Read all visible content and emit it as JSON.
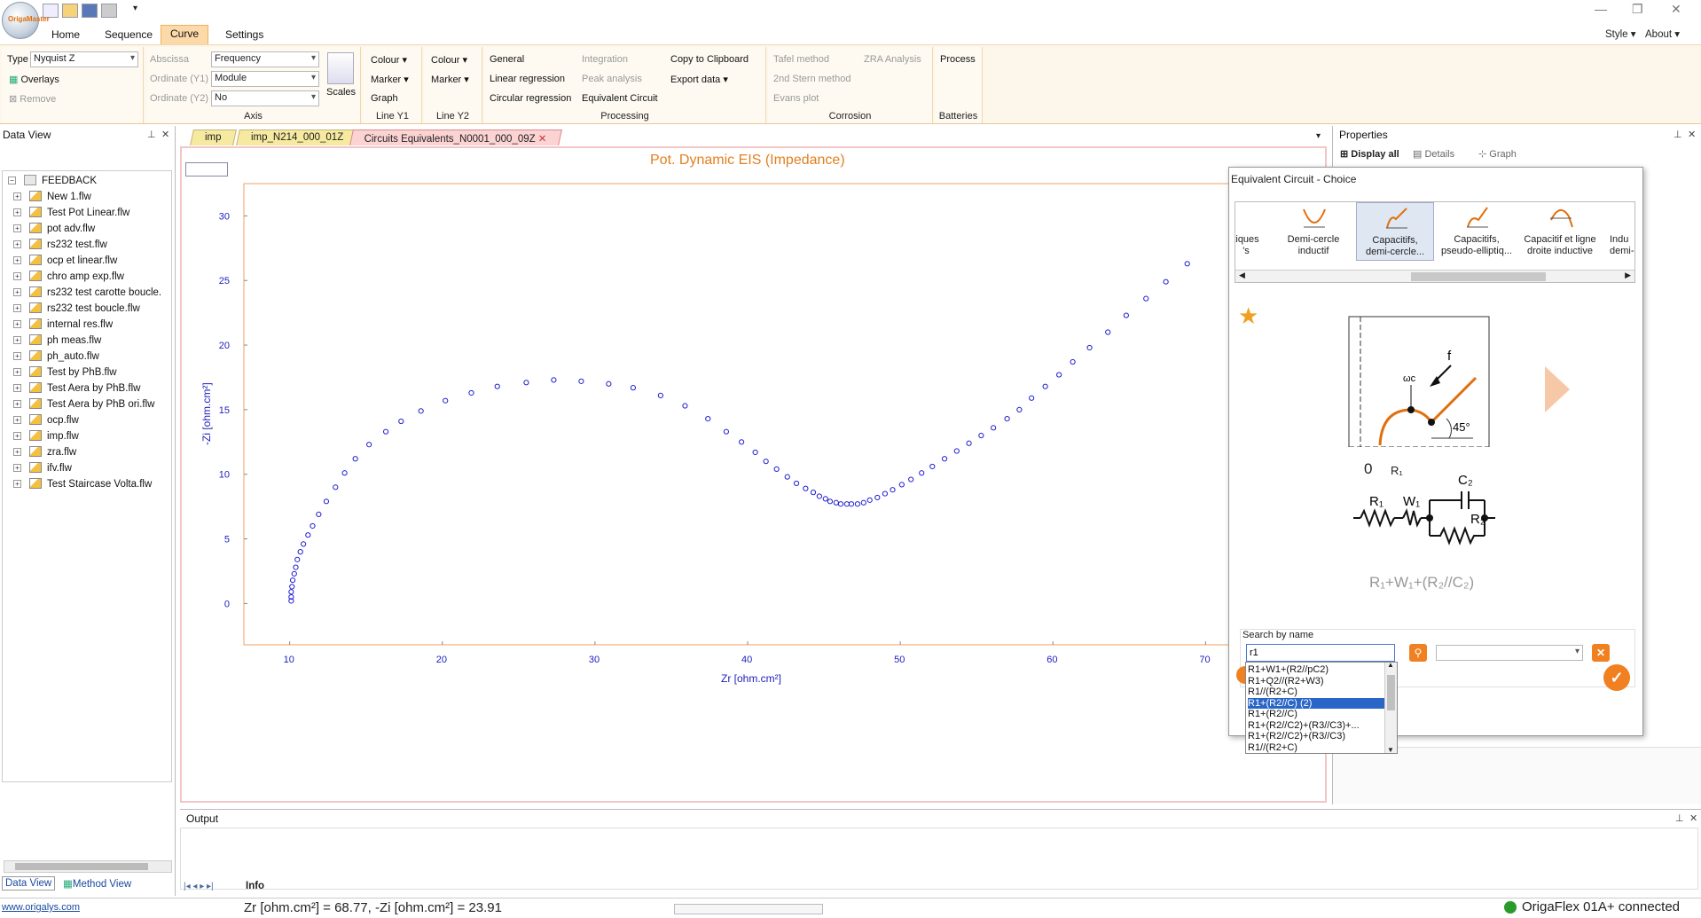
{
  "app": {
    "quick_access": [
      "new",
      "open",
      "save",
      "print"
    ],
    "style_label": "Style",
    "about_label": "About"
  },
  "ribbon": {
    "tabs": [
      "Home",
      "Sequence",
      "Curve",
      "Settings"
    ],
    "type_label": "Type",
    "type_value": "Nyquist Z",
    "overlays": "Overlays",
    "remove": "Remove",
    "abscissa_label": "Abscissa",
    "abscissa_value": "Frequency",
    "ordinate1_label": "Ordinate (Y1)",
    "ordinate1_value": "Module",
    "ordinate2_label": "Ordinate (Y2)",
    "ordinate2_value": "No",
    "scales": "Scales",
    "axis_group": "Axis",
    "colour": "Colour",
    "marker": "Marker",
    "graph": "Graph",
    "line_y1": "Line Y1",
    "line_y2": "Line Y2",
    "general": "General",
    "integration": "Integration",
    "copy_clipboard": "Copy to Clipboard",
    "linear_regression": "Linear regression",
    "peak_analysis": "Peak analysis",
    "export_data": "Export data",
    "circular_regression": "Circular regression",
    "equivalent_circuit": "Equivalent Circuit",
    "processing": "Processing",
    "tafel": "Tafel method",
    "zra": "ZRA Analysis",
    "stern": "2nd Stern method",
    "evans": "Evans plot",
    "corrosion": "Corrosion",
    "process": "Process",
    "batteries": "Batteries"
  },
  "dataview": {
    "title": "Data View",
    "root": "FEEDBACK",
    "items": [
      "New 1.flw",
      "Test Pot Linear.flw",
      "pot adv.flw",
      "rs232 test.flw",
      "ocp et linear.flw",
      "chro amp exp.flw",
      "rs232 test carotte boucle.",
      "rs232 test boucle.flw",
      "internal res.flw",
      "ph meas.flw",
      "ph_auto.flw",
      "Test by PhB.flw",
      "Test Aera by PhB.flw",
      "Test Aera by PhB ori.flw",
      "ocp.flw",
      "imp.flw",
      "zra.flw",
      "ifv.flw",
      "Test Staircase Volta.flw"
    ],
    "tab_data": "Data View",
    "tab_method": "Method View"
  },
  "doc_tabs": [
    "imp",
    "imp_N214_000_01Z",
    "Circuits Equivalents_N0001_000_09Z"
  ],
  "chart_data": {
    "type": "scatter",
    "title": "Pot. Dynamic EIS (Impedance)",
    "xlabel": "Zr [ohm.cm²]",
    "ylabel": "-Zi [ohm.cm²]",
    "xlim": [
      7,
      73
    ],
    "ylim": [
      -3.2,
      32.5
    ],
    "xticks": [
      10,
      20,
      30,
      40,
      50,
      60,
      70
    ],
    "yticks": [
      0,
      5,
      10,
      15,
      20,
      25,
      30
    ],
    "color": "#2020d0",
    "x": [
      10.1,
      10.1,
      10.1,
      10.15,
      10.2,
      10.3,
      10.4,
      10.5,
      10.7,
      10.9,
      11.2,
      11.5,
      11.9,
      12.4,
      13.0,
      13.6,
      14.3,
      15.2,
      16.3,
      17.3,
      18.6,
      20.2,
      21.9,
      23.6,
      25.5,
      27.3,
      29.1,
      30.9,
      32.5,
      34.3,
      35.9,
      37.4,
      38.6,
      39.6,
      40.5,
      41.2,
      41.9,
      42.6,
      43.2,
      43.8,
      44.3,
      44.7,
      45.1,
      45.4,
      45.8,
      46.1,
      46.5,
      46.8,
      47.2,
      47.6,
      48.0,
      48.5,
      49.0,
      49.5,
      50.1,
      50.7,
      51.4,
      52.1,
      52.9,
      53.7,
      54.5,
      55.3,
      56.1,
      57.0,
      57.8,
      58.6,
      59.5,
      60.4,
      61.3,
      62.4,
      63.6,
      64.8,
      66.1,
      67.4,
      68.8
    ],
    "y": [
      0.2,
      0.5,
      0.9,
      1.3,
      1.8,
      2.3,
      2.8,
      3.4,
      4.0,
      4.6,
      5.3,
      6.0,
      6.9,
      7.9,
      9.0,
      10.1,
      11.2,
      12.3,
      13.3,
      14.1,
      14.9,
      15.7,
      16.3,
      16.8,
      17.1,
      17.3,
      17.2,
      17.0,
      16.7,
      16.1,
      15.3,
      14.3,
      13.3,
      12.5,
      11.7,
      11.0,
      10.4,
      9.8,
      9.3,
      8.9,
      8.6,
      8.3,
      8.1,
      7.9,
      7.8,
      7.7,
      7.7,
      7.7,
      7.7,
      7.8,
      8.0,
      8.2,
      8.5,
      8.8,
      9.2,
      9.6,
      10.1,
      10.6,
      11.2,
      11.8,
      12.4,
      13.0,
      13.6,
      14.3,
      15.0,
      15.9,
      16.8,
      17.7,
      18.7,
      19.8,
      21.0,
      22.3,
      23.6,
      24.9,
      26.3
    ]
  },
  "properties": {
    "title": "Properties",
    "display_all": "Display all",
    "details": "Details",
    "graph": "Graph"
  },
  "dialog": {
    "title": "Equivalent Circuit - Choice",
    "tiles": [
      {
        "l1": "tiques",
        "l2": "'s"
      },
      {
        "l1": "Demi-cercle",
        "l2": "inductif"
      },
      {
        "l1": "Capacitifs,",
        "l2": "demi-cercle..."
      },
      {
        "l1": "Capacitifs,",
        "l2": "pseudo-elliptiq..."
      },
      {
        "l1": "Capacitif et ligne",
        "l2": "droite inductive"
      },
      {
        "l1": "Indu",
        "l2": "demi-c"
      }
    ],
    "diagram": {
      "zero": "0",
      "r1": "R₁",
      "wc": "ωc",
      "f": "f",
      "angle": "45°",
      "c2": "C₂",
      "r1b": "R₁",
      "w1": "W₁",
      "r2": "R₂"
    },
    "formula": "R₁+W₁+(R₂//C₂)",
    "search_label": "Search by name",
    "search_value": "r1",
    "results": [
      "R1+W1+(R2//pC2)",
      "R1+Q2//(R2+W3)",
      "R1//(R2+C)",
      "R1+(R2//C) (2)",
      "R1+(R2//C)",
      "R1+(R2//C2)+(R3//C3)+...",
      "R1+(R2//C2)+(R3//C3)",
      "R1//(R2+C)"
    ],
    "selected_index": 3
  },
  "output": {
    "title": "Output",
    "tab_info": "Info"
  },
  "status": {
    "link": "www.origalys.com",
    "coords": "Zr [ohm.cm²] = 68.77, -Zi [ohm.cm²] = 23.91",
    "device": "OrigaFlex 01A+ connected"
  }
}
